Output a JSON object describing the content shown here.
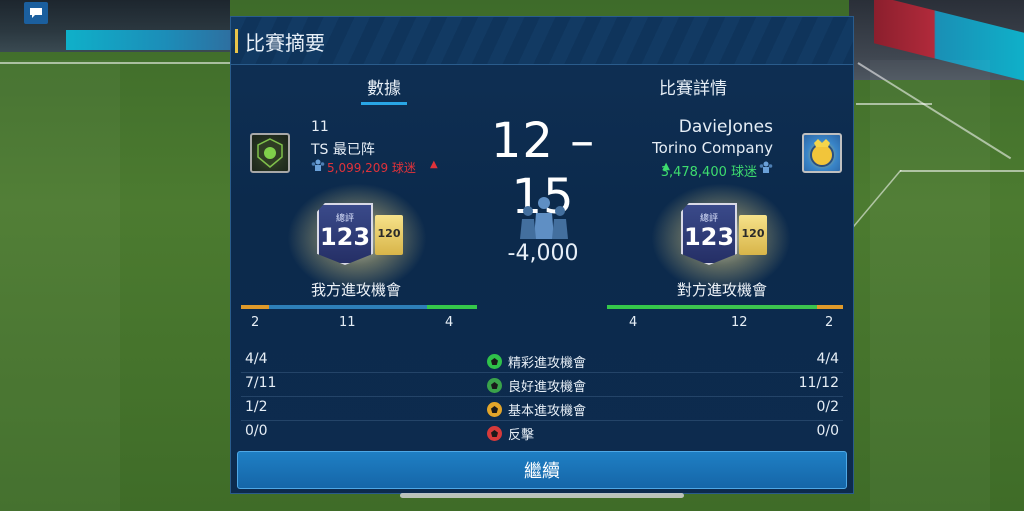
{
  "panel": {
    "title": "比賽摘要",
    "tabs": [
      {
        "label": "數據",
        "active": true
      },
      {
        "label": "比賽詳情",
        "active": false
      }
    ]
  },
  "home": {
    "level": "11",
    "name": "TS 最已阵",
    "fans": "5,099,209 球迷",
    "rating_label": "總評",
    "rating": "123",
    "rating_sub": "120",
    "chance_title": "我方進攻機會",
    "chance_numbers": [
      "2",
      "11",
      "4"
    ]
  },
  "away": {
    "name": "DavieJones",
    "club": "Torino Company",
    "fans": "3,478,400 球迷",
    "rating_label": "總評",
    "rating": "123",
    "rating_sub": "120",
    "chance_title": "對方進攻機會",
    "chance_numbers": [
      "4",
      "12",
      "2"
    ]
  },
  "score": {
    "home": "12",
    "separator": "–",
    "away": "15"
  },
  "attendance_change": "-4,000",
  "stats": [
    {
      "home": "4/4",
      "label": "精彩進攻機會",
      "away": "4/4",
      "ball_color": "#2fc24a"
    },
    {
      "home": "7/11",
      "label": "良好進攻機會",
      "away": "11/12",
      "ball_color": "#3aa34a"
    },
    {
      "home": "1/2",
      "label": "基本進攻機會",
      "away": "0/2",
      "ball_color": "#e2a52a"
    },
    {
      "home": "0/0",
      "label": "反擊",
      "away": "0/0",
      "ball_color": "#d63a3a"
    }
  ],
  "continue_label": "繼續",
  "colors": {
    "accent": "#29a6e6",
    "fans_down": "#e0323a",
    "fans_up": "#3ddc6e"
  },
  "icons": [
    "chat-icon",
    "home-club-badge-icon",
    "away-club-badge-icon",
    "crowd-icon",
    "football-icon"
  ]
}
